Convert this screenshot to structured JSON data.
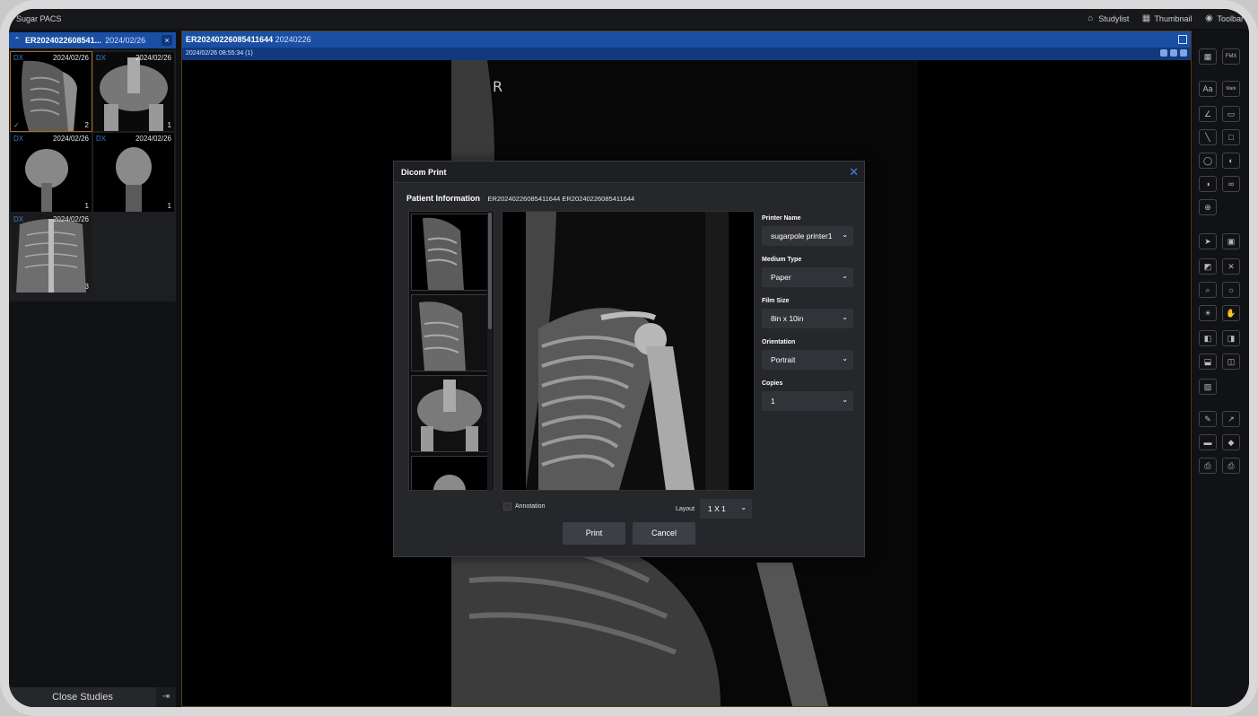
{
  "app": {
    "title": "Sugar PACS"
  },
  "topnav": [
    {
      "icon": "home-icon",
      "label": "Studylist"
    },
    {
      "icon": "grid-icon",
      "label": "Thumbnail"
    },
    {
      "icon": "eye-icon",
      "label": "Toolbar"
    }
  ],
  "study_tab": {
    "id": "ER2024022608541...",
    "date": "2024/02/26",
    "close": "×"
  },
  "thumbnails": [
    {
      "modality": "DX",
      "date": "2024/02/26",
      "count": "2",
      "selected": true,
      "checked": true
    },
    {
      "modality": "DX",
      "date": "2024/02/26",
      "count": "1",
      "selected": false,
      "checked": false
    },
    {
      "modality": "DX",
      "date": "2024/02/26",
      "count": "1",
      "selected": false,
      "checked": false
    },
    {
      "modality": "DX",
      "date": "2024/02/26",
      "count": "1",
      "selected": false,
      "checked": false
    },
    {
      "modality": "DX",
      "date": "2024/02/26",
      "count": "3",
      "selected": false,
      "checked": false
    }
  ],
  "close_studies": "Close Studies",
  "viewer": {
    "patient_id": "ER20240226085411644",
    "study_date": "20240226",
    "sub_info": "2024/02/26 08:55:34 (1)",
    "orientation_marker": "R"
  },
  "toolbar_labels": {
    "fmx": "FMX",
    "text": "Aa",
    "mark": "Mark"
  },
  "dialog": {
    "title": "Dicom Print",
    "patient_info_label": "Patient Information",
    "patient_info_value": "ER20240226085411644 ER20240226085411644",
    "printer_name_label": "Printer Name",
    "printer_name_value": "sugarpole printer1",
    "medium_type_label": "Medium Type",
    "medium_type_value": "Paper",
    "film_size_label": "Film Size",
    "film_size_value": "8in x 10in",
    "orientation_label": "Orientation",
    "orientation_value": "Portrait",
    "copies_label": "Copies",
    "copies_value": "1",
    "annotation_label": "Annotation",
    "layout_label": "Layout",
    "layout_value": "1 X 1",
    "print_button": "Print",
    "cancel_button": "Cancel"
  }
}
